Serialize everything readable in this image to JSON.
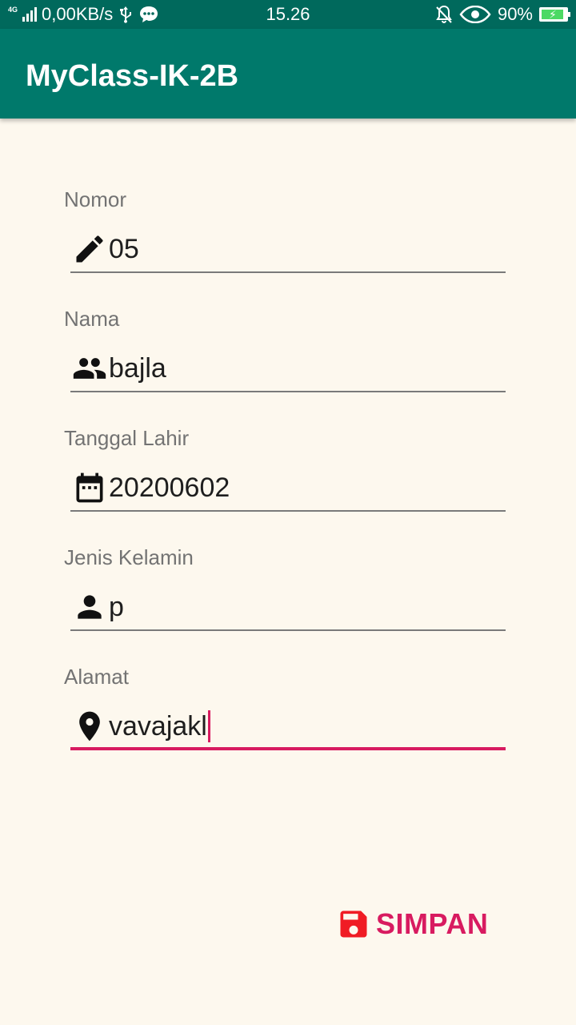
{
  "status_bar": {
    "network": "4G",
    "speed": "0,00KB/s",
    "time": "15.26",
    "battery": "90%"
  },
  "app_bar": {
    "title": "MyClass-IK-2B"
  },
  "form": {
    "fields": [
      {
        "label": "Nomor",
        "value": "05",
        "icon": "pencil-icon"
      },
      {
        "label": "Nama",
        "value": "bajla",
        "icon": "people-icon"
      },
      {
        "label": "Tanggal Lahir",
        "value": "20200602",
        "icon": "calendar-icon"
      },
      {
        "label": "Jenis Kelamin",
        "value": "p",
        "icon": "person-icon"
      },
      {
        "label": "Alamat",
        "value": "vavajakl",
        "icon": "location-pin-icon"
      }
    ]
  },
  "save_button": {
    "label": "SIMPAN",
    "icon": "floppy-disk-icon"
  },
  "colors": {
    "primary": "#00796b",
    "primary_dark": "#00695c",
    "accent": "#d81b60",
    "background": "#fdf8ee"
  }
}
